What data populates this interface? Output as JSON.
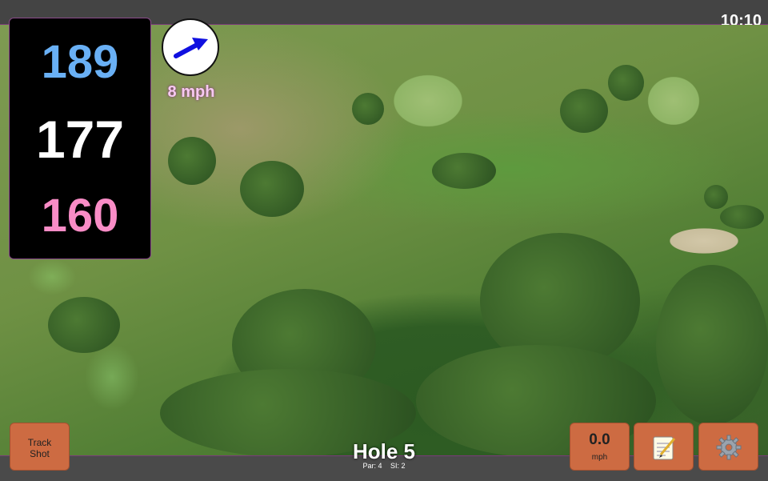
{
  "status_bar": {
    "time": "10:10"
  },
  "distances": {
    "back": "189",
    "middle": "177",
    "front": "160",
    "colors": {
      "back": "#69b0f5",
      "middle": "#ffffff",
      "front": "#f98cc6"
    }
  },
  "wind": {
    "speed": "8 mph",
    "icon": "wind-direction-arrow-icon"
  },
  "buttons": {
    "track_shot": {
      "line1": "Track",
      "line2": "Shot"
    },
    "speed": {
      "value": "0.0",
      "unit": "mph"
    },
    "notes": {
      "icon": "notepad-icon"
    },
    "settings": {
      "icon": "gear-icon"
    },
    "accent": "#cd6b42"
  },
  "hole": {
    "title": "Hole 5",
    "par_label": "Par: 4",
    "si_label": "SI: 2"
  }
}
